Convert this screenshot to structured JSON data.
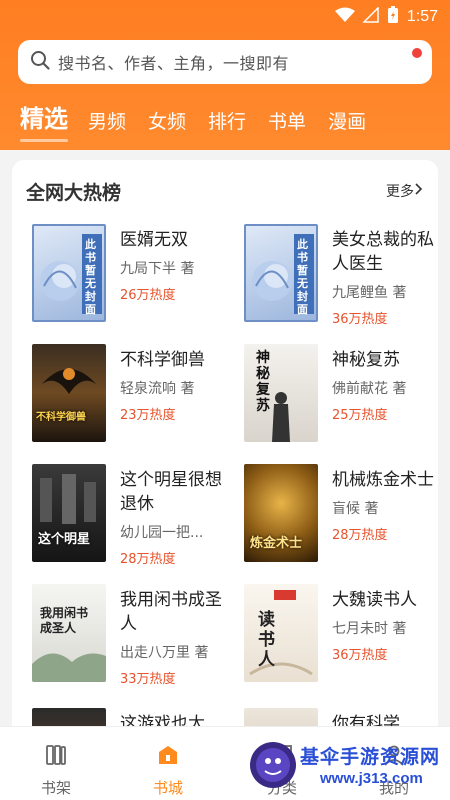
{
  "status_bar": {
    "time": "1:57"
  },
  "search": {
    "placeholder": "搜书名、作者、主角，一搜即有"
  },
  "tabs": [
    {
      "label": "精选",
      "active": true
    },
    {
      "label": "男频"
    },
    {
      "label": "女频"
    },
    {
      "label": "排行"
    },
    {
      "label": "书单"
    },
    {
      "label": "漫画"
    }
  ],
  "ranking": {
    "title": "全网大热榜",
    "more": "更多",
    "books": [
      {
        "name": "医婿无双",
        "author": "九局下半 著",
        "heat": "26万热度",
        "cover_text": "此书暂无封面"
      },
      {
        "name": "美女总裁的私人医生",
        "author": "九尾鲤鱼 著",
        "heat": "36万热度",
        "cover_text": "此书暂无封面"
      },
      {
        "name": "不科学御兽",
        "author": "轻泉流响 著",
        "heat": "23万热度",
        "cover_text": "不科学御兽"
      },
      {
        "name": "神秘复苏",
        "author": "佛前献花 著",
        "heat": "25万热度",
        "cover_text": "神秘复苏"
      },
      {
        "name": "这个明星很想退休",
        "author": "幼儿园一把...",
        "heat": "28万热度",
        "cover_text": "这个明星"
      },
      {
        "name": "机械炼金术士",
        "author": "盲候 著",
        "heat": "28万热度",
        "cover_text": "炼金术士"
      },
      {
        "name": "我用闲书成圣人",
        "author": "出走八万里 著",
        "heat": "33万热度",
        "cover_text": "我用闲书成圣人"
      },
      {
        "name": "大魏读书人",
        "author": "七月未时 著",
        "heat": "36万热度",
        "cover_text": "读书人"
      },
      {
        "name": "这游戏也太",
        "author": "",
        "heat": ""
      },
      {
        "name": "你有科学",
        "author": "",
        "heat": ""
      }
    ]
  },
  "bottom_nav": [
    {
      "label": "书架",
      "icon": "bookshelf-icon"
    },
    {
      "label": "书城",
      "icon": "bookstore-icon",
      "active": true
    },
    {
      "label": "分类",
      "icon": "category-icon"
    },
    {
      "label": "我的",
      "icon": "profile-icon"
    }
  ],
  "watermark": {
    "title": "基伞手游资源网",
    "url": "www.j313.com"
  },
  "colors": {
    "accent": "#ff8a1e",
    "heat": "#e7532d"
  }
}
